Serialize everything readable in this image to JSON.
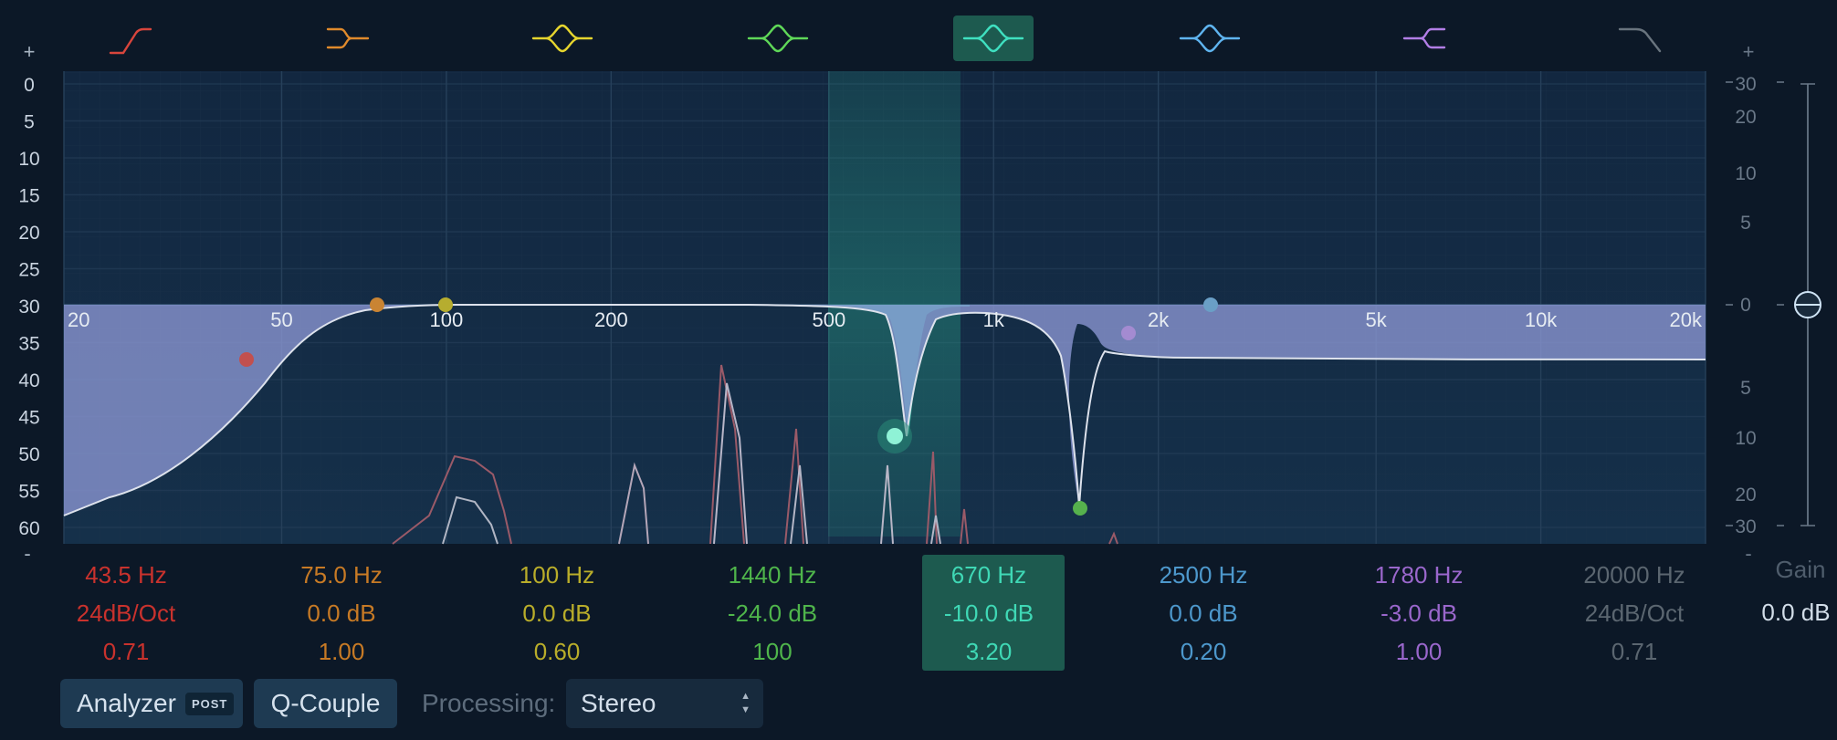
{
  "colors": {
    "bg": "#0c1827",
    "plot_bg": "#142a42",
    "grid": "#233d57",
    "selected_band": "#38c4a7",
    "curve_fill": "#8c97d4",
    "curve_line": "#dde2ec"
  },
  "toolbar": {
    "plus_left": "+",
    "plus_right": "+"
  },
  "band_icons": [
    {
      "icon": "low-cut-icon",
      "color": "#d8453c",
      "selected": false
    },
    {
      "icon": "low-shelf-icon",
      "color": "#e08a2c",
      "selected": false
    },
    {
      "icon": "bell-icon",
      "color": "#e6d52e",
      "selected": false
    },
    {
      "icon": "bell-icon",
      "color": "#5fd858",
      "selected": false
    },
    {
      "icon": "bell-icon",
      "color": "#3fe0c0",
      "selected": true
    },
    {
      "icon": "bell-icon",
      "color": "#5fb4ef",
      "selected": false
    },
    {
      "icon": "high-shelf-icon",
      "color": "#b27ee6",
      "selected": false
    },
    {
      "icon": "high-cut-icon",
      "color": "#69747e",
      "selected": false
    }
  ],
  "analyzer_scale": {
    "labels": [
      "0",
      "5",
      "10",
      "15",
      "20",
      "25",
      "30",
      "35",
      "40",
      "45",
      "50",
      "55",
      "60"
    ],
    "minus": "-"
  },
  "freq_axis": {
    "labels": [
      "20",
      "50",
      "100",
      "200",
      "500",
      "1k",
      "2k",
      "5k",
      "10k",
      "20k"
    ],
    "values": [
      20,
      50,
      100,
      200,
      500,
      1000,
      2000,
      5000,
      10000,
      20000
    ]
  },
  "gain_axis": {
    "labels": [
      "30",
      "20",
      "10",
      "5",
      "0",
      "5",
      "10",
      "20",
      "30"
    ],
    "minus": "-"
  },
  "bands": [
    {
      "freq": "43.5 Hz",
      "gain": "24dB/Oct",
      "q": "0.71",
      "color": "#c9322d",
      "selected": false
    },
    {
      "freq": "75.0 Hz",
      "gain": "0.0 dB",
      "q": "1.00",
      "color": "#c77a25",
      "selected": false
    },
    {
      "freq": "100 Hz",
      "gain": "0.0 dB",
      "q": "0.60",
      "color": "#b9ad2a",
      "selected": false
    },
    {
      "freq": "1440 Hz",
      "gain": "-24.0 dB",
      "q": "100",
      "color": "#4fb54b",
      "selected": false
    },
    {
      "freq": "670 Hz",
      "gain": "-10.0 dB",
      "q": "3.20",
      "color": "#3fd8b5",
      "selected": true
    },
    {
      "freq": "2500 Hz",
      "gain": "0.0 dB",
      "q": "0.20",
      "color": "#4d98cc",
      "selected": false
    },
    {
      "freq": "1780 Hz",
      "gain": "-3.0 dB",
      "q": "1.00",
      "color": "#9a67cc",
      "selected": false
    },
    {
      "freq": "20000 Hz",
      "gain": "24dB/Oct",
      "q": "0.71",
      "color": "#5b6670",
      "selected": false
    }
  ],
  "output": {
    "label": "Gain",
    "value": "0.0 dB"
  },
  "controls": {
    "analyzer_label": "Analyzer",
    "analyzer_badge": "POST",
    "qcouple_label": "Q-Couple",
    "processing_label": "Processing:",
    "processing_value": "Stereo"
  }
}
